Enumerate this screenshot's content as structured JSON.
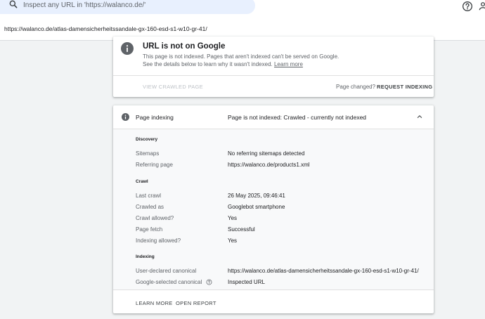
{
  "search": {
    "placeholder": "Inspect any URL in 'https://walanco.de/'",
    "icon": "search-icon"
  },
  "header": {
    "help_icon": "help-icon",
    "account_icon": "account-icon"
  },
  "inspected_url": "https://walanco.de/atlas-damensicherheitssandale-gx-160-esd-s1-w10-gr-41/",
  "status_card": {
    "icon": "info-icon",
    "title": "URL is not on Google",
    "description": "This page is not indexed. Pages that aren't indexed can't be served on Google. See the details below to learn why it wasn't indexed.",
    "learn_more": "Learn more",
    "view_crawled_page": "VIEW CRAWLED PAGE",
    "page_changed": "Page changed?",
    "request_indexing": "REQUEST INDEXING"
  },
  "indexing_card": {
    "title": "Page indexing",
    "status": "Page is not indexed: Crawled - currently not indexed",
    "discovery": {
      "heading": "Discovery",
      "rows": [
        {
          "label": "Sitemaps",
          "value": "No referring sitemaps detected"
        },
        {
          "label": "Referring page",
          "value": "https://walanco.de/products1.xml"
        }
      ]
    },
    "crawl": {
      "heading": "Crawl",
      "rows": [
        {
          "label": "Last crawl",
          "value": "26 May 2025, 09:46:41"
        },
        {
          "label": "Crawled as",
          "value": "Googlebot smartphone"
        },
        {
          "label": "Crawl allowed?",
          "value": "Yes"
        },
        {
          "label": "Page fetch",
          "value": "Successful"
        },
        {
          "label": "Indexing allowed?",
          "value": "Yes"
        }
      ]
    },
    "indexing": {
      "heading": "Indexing",
      "rows": [
        {
          "label": "User-declared canonical",
          "value": "https://walanco.de/atlas-damensicherheitssandale-gx-160-esd-s1-w10-gr-41/"
        },
        {
          "label": "Google-selected canonical",
          "value": "Inspected URL"
        }
      ]
    },
    "footer": {
      "learn_more": "LEARN MORE",
      "open_report": "OPEN REPORT"
    }
  },
  "colors": {
    "search_bg": "#e8f0fe",
    "page_bg": "#f1f3f4",
    "card_bg": "#ffffff",
    "details_bg": "#f8f9fa",
    "icon_gray": "#5f6368"
  }
}
